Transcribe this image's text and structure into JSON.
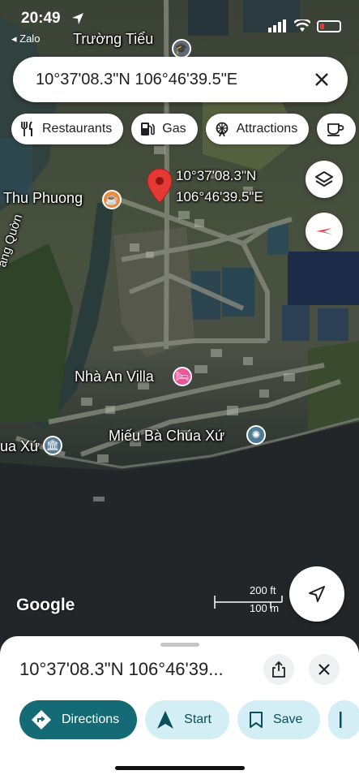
{
  "status_bar": {
    "time": "20:49",
    "back_app": "◂ Zalo"
  },
  "search": {
    "query": "10°37'08.3\"N 106°46'39.5\"E"
  },
  "chips": [
    {
      "label": "Restaurants",
      "icon": "fork-knife-icon"
    },
    {
      "label": "Gas",
      "icon": "gas-pump-icon"
    },
    {
      "label": "Attractions",
      "icon": "ferris-wheel-icon"
    }
  ],
  "map": {
    "pin_line1": "10°37'08.3\"N",
    "pin_line2": "106°46'39.5\"E",
    "labels": {
      "truong_tieu": "Trường Tiểu",
      "thu_phuong": "Thu Phuong",
      "quon": "ang Quờn",
      "nha_an_villa": "Nhà An Villa",
      "mieu": "Miếu Bà Chúa Xứ",
      "ua_xu": "ua Xứ"
    },
    "google": "Google",
    "scale_ft": "200 ft",
    "scale_m": "100 m"
  },
  "sheet": {
    "title": "10°37'08.3\"N 106°46'39...",
    "actions": [
      {
        "label": "Directions",
        "icon": "directions-icon"
      },
      {
        "label": "Start",
        "icon": "navigation-arrow-icon"
      },
      {
        "label": "Save",
        "icon": "bookmark-icon"
      }
    ]
  },
  "colors": {
    "pin": "#e53935",
    "primary_action": "#146b75",
    "secondary_action": "#d4eef6"
  }
}
